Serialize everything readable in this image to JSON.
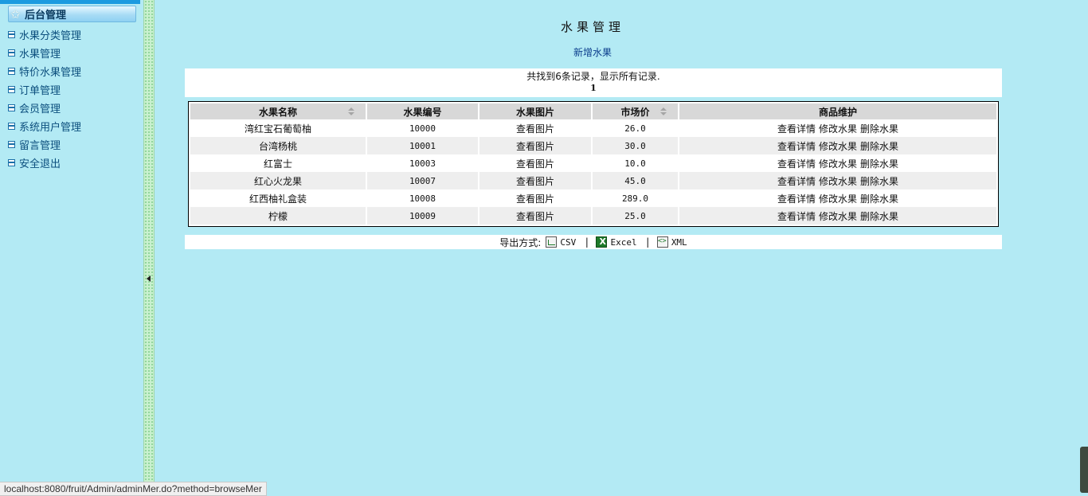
{
  "sidebar": {
    "header": "后台管理",
    "items": [
      {
        "label": "水果分类管理"
      },
      {
        "label": "水果管理"
      },
      {
        "label": "特价水果管理"
      },
      {
        "label": "订单管理"
      },
      {
        "label": "会员管理"
      },
      {
        "label": "系统用户管理"
      },
      {
        "label": "留言管理"
      },
      {
        "label": "安全退出"
      }
    ]
  },
  "main": {
    "title": "水果管理",
    "add_link": "新增水果",
    "summary": "共找到6条记录，显示所有记录.",
    "page": "1",
    "columns": [
      "水果名称",
      "水果编号",
      "水果图片",
      "市场价",
      "商品维护"
    ],
    "rows": [
      {
        "name": "湾红宝石葡萄柚",
        "id": "10000",
        "image": "查看图片",
        "price": "26.0"
      },
      {
        "name": "台湾杨桃",
        "id": "10001",
        "image": "查看图片",
        "price": "30.0"
      },
      {
        "name": "红富士",
        "id": "10003",
        "image": "查看图片",
        "price": "10.0"
      },
      {
        "name": "红心火龙果",
        "id": "10007",
        "image": "查看图片",
        "price": "45.0"
      },
      {
        "name": "红西柚礼盒装",
        "id": "10008",
        "image": "查看图片",
        "price": "289.0"
      },
      {
        "name": "柠檬",
        "id": "10009",
        "image": "查看图片",
        "price": "25.0"
      }
    ],
    "actions": [
      "查看详情",
      "修改水果",
      "删除水果"
    ],
    "export": {
      "label": "导出方式:",
      "options": [
        "CSV",
        "Excel",
        "XML"
      ]
    }
  },
  "status_bar": {
    "url": "localhost:8080/fruit/Admin/adminMer.do?method=browseMer"
  },
  "colors": {
    "background": "#b3eaf4",
    "link": "#0b3d8c",
    "sidebar_text": "#0c4f7e"
  }
}
